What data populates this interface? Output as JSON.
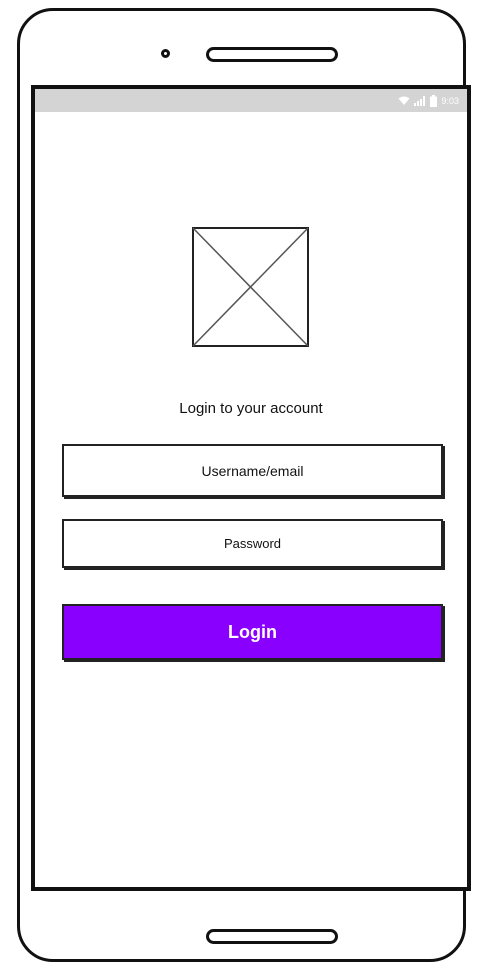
{
  "status_bar": {
    "time": "9:03",
    "icons": [
      "wifi-icon",
      "signal-icon",
      "battery-icon"
    ]
  },
  "login": {
    "title": "Login to your account",
    "username_placeholder": "Username/email",
    "password_placeholder": "Password",
    "button_label": "Login"
  },
  "colors": {
    "accent": "#8a00ff",
    "status_bar": "#d4d4d4",
    "outline": "#111111"
  }
}
